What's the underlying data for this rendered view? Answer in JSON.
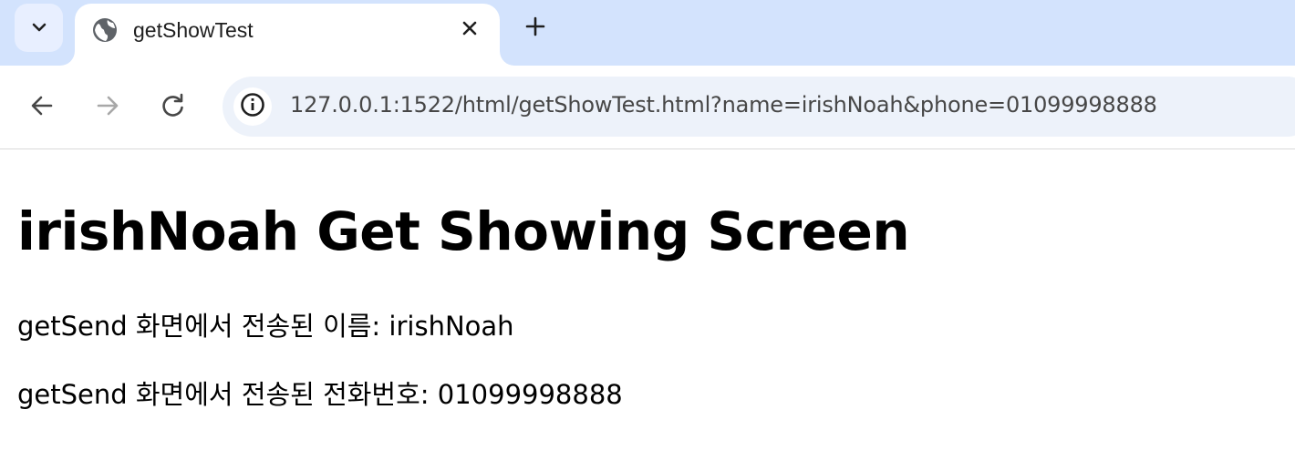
{
  "browser": {
    "tab": {
      "title": "getShowTest"
    },
    "address_bar": {
      "url": "127.0.0.1:1522/html/getShowTest.html?name=irishNoah&phone=01099998888"
    }
  },
  "page": {
    "heading": "irishNoah Get Showing Screen",
    "name_line": "getSend 화면에서 전송된 이름: irishNoah",
    "phone_line": "getSend 화면에서 전송된 전화번호: 01099998888"
  }
}
